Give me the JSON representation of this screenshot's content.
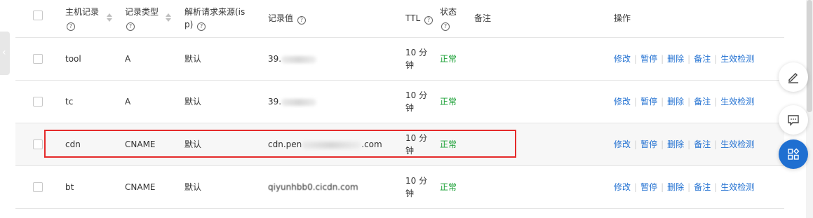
{
  "columns": {
    "host": "主机记录",
    "type": "记录类型",
    "source_line1": "解析请求来源(is",
    "source_line2": "p)",
    "value": "记录值",
    "ttl": "TTL",
    "status": "状态",
    "remark": "备注",
    "actions": "操作"
  },
  "rows": [
    {
      "host": "tool",
      "type": "A",
      "source": "默认",
      "value_prefix": "39.",
      "value_suffix": "",
      "ttl_line1": "10 分",
      "ttl_line2": "钟",
      "status": "正常"
    },
    {
      "host": "tc",
      "type": "A",
      "source": "默认",
      "value_prefix": "39.",
      "value_suffix": "",
      "ttl_line1": "10 分",
      "ttl_line2": "钟",
      "status": "正常"
    },
    {
      "host": "cdn",
      "type": "CNAME",
      "source": "默认",
      "value_prefix": "cdn.pen",
      "value_suffix": ".com",
      "ttl_line1": "10 分",
      "ttl_line2": "钟",
      "status": "正常"
    },
    {
      "host": "bt",
      "type": "CNAME",
      "source": "默认",
      "value_prefix": "qiyunhbb0.cicdn.com",
      "value_suffix": "",
      "ttl_line1": "10 分",
      "ttl_line2": "钟",
      "status": "正常"
    }
  ],
  "actions": {
    "edit": "修改",
    "pause": "暂停",
    "delete": "删除",
    "remark": "备注",
    "check": "生效检测"
  },
  "colors": {
    "link": "#1f6fd1",
    "status_ok": "#1aa035",
    "highlight": "#e52b2b",
    "fab_blue": "#1f6fd1"
  },
  "icons": {
    "left": "chevron-left-icon",
    "fab1": "edit-pen-icon",
    "fab2": "chat-icon",
    "fab3": "apps-icon"
  }
}
